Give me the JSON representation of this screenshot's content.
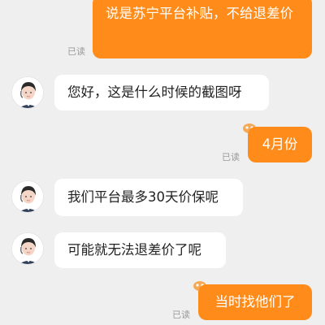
{
  "messages": [
    {
      "side": "me",
      "text": "说是苏宁平台补贴，不给退差价",
      "status": "已读"
    },
    {
      "side": "them",
      "text": "您好，这是什么时候的截图呀"
    },
    {
      "side": "me",
      "text": "4月份",
      "status": "已读"
    },
    {
      "side": "them",
      "text": "我们平台最多30天价保呢"
    },
    {
      "side": "them",
      "text": "可能就无法退差价了呢"
    },
    {
      "side": "me",
      "text": "当时找他们了",
      "status": "已读"
    }
  ],
  "colors": {
    "background": "#efeff0",
    "outgoing_bubble": "#ff8c1a",
    "incoming_bubble": "#ffffff",
    "read_status": "#9a9a9a"
  },
  "icons": {
    "agent_avatar": "customer-service-agent-avatar",
    "bubble_decoration": "paw-decoration-icon"
  }
}
